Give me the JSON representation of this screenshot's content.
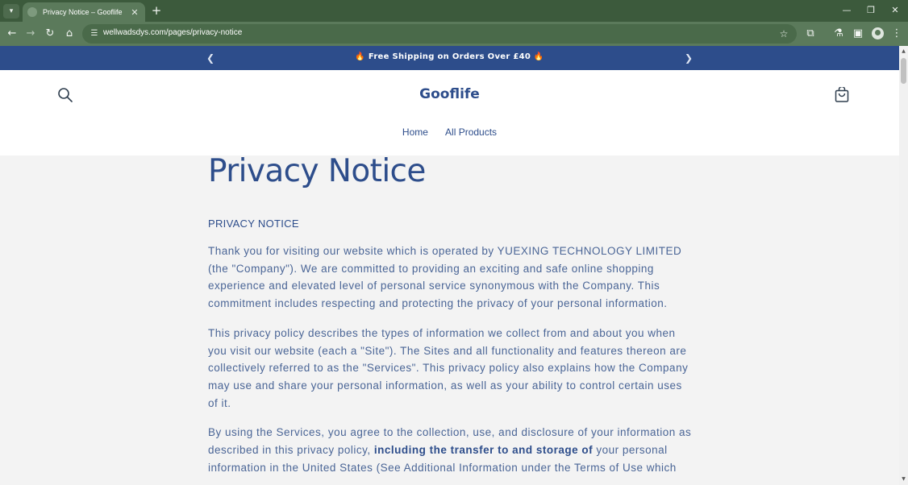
{
  "browser": {
    "tab_title": "Privacy Notice – Gooflife",
    "tab_close": "✕",
    "new_tab": "+",
    "url": "wellwadsdys.com/pages/privacy-notice",
    "icons": [
      "tab-list-icon",
      "favicon-icon",
      "close-icon",
      "new-tab-icon",
      "minimize-icon",
      "restore-icon",
      "close-window-icon",
      "back-icon",
      "forward-icon",
      "reload-icon",
      "home-icon",
      "site-info-icon",
      "bookmark-star-icon",
      "extensions-icon",
      "labs-icon",
      "side-panel-icon",
      "profile-icon",
      "menu-icon"
    ]
  },
  "announcement": {
    "text": "🔥 Free Shipping on Orders Over £40 🔥"
  },
  "header": {
    "logo": "Gooflife",
    "nav": [
      "Home",
      "All Products"
    ]
  },
  "content": {
    "title": "Privacy Notice",
    "subtitle": "PRIVACY NOTICE",
    "paragraphs": [
      "Thank you for visiting our website which is operated by YUEXING TECHNOLOGY LIMITED (the \"Company\"). We are committed to providing an exciting and safe online shopping experience and elevated level of personal service synonymous with the Company. This commitment includes respecting and protecting the privacy of your personal information.",
      "This privacy policy describes the types of information we collect from and about you when you visit our website (each a \"Site\"). The Sites and all functionality and features thereon are collectively referred to as the \"Services\". This privacy policy also explains how the Company may use and share your personal information, as well as your ability to control certain uses of it."
    ],
    "paragraph3": {
      "lead": "By using the Services, you agree to the collection, use, and disclosure of your information as described in this privacy policy, ",
      "strong": "including the transfer to and storage of",
      "tail": " your personal information in the United States (See Additional Information under the Terms of Use which"
    }
  },
  "colors": {
    "brand": "#2d4d8b",
    "browser_frame": "#3c5a3c",
    "browser_toolbar": "#5b7a5b"
  }
}
